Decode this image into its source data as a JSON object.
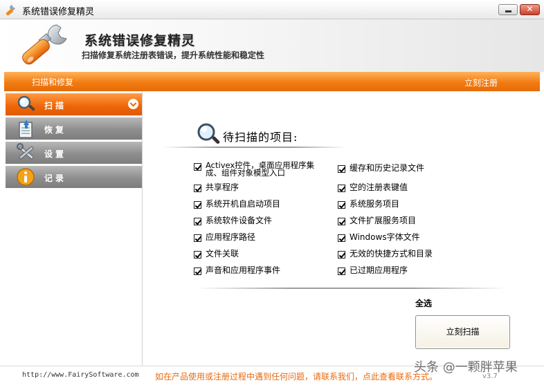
{
  "window": {
    "title": "系统错误修复精灵",
    "close_glyph": "✕"
  },
  "header": {
    "title": "系统错误修复精灵",
    "subtitle": "扫描修复系统注册表错误，提升系统性能和稳定性",
    "logo_icon": "wrench-icon"
  },
  "nav": {
    "left_label": "扫描和修复",
    "right_link": "立刻注册"
  },
  "sidebar": {
    "items": [
      {
        "label": "扫描",
        "icon": "magnifier-icon",
        "active": true
      },
      {
        "label": "恢复",
        "icon": "restore-icon",
        "active": false
      },
      {
        "label": "设置",
        "icon": "tools-icon",
        "active": false
      },
      {
        "label": "记录",
        "icon": "info-icon",
        "active": false
      }
    ]
  },
  "main": {
    "section_title": "待扫描的项目:",
    "left_items": [
      {
        "label": "Activex控件，桌面应用程序集成、组件对象模型入口",
        "checked": true
      },
      {
        "label": "共享程序",
        "checked": true
      },
      {
        "label": "系统开机自启动项目",
        "checked": true
      },
      {
        "label": "系统软件设备文件",
        "checked": true
      },
      {
        "label": "应用程序路径",
        "checked": true
      },
      {
        "label": "文件关联",
        "checked": true
      },
      {
        "label": "声音和应用程序事件",
        "checked": true
      }
    ],
    "right_items": [
      {
        "label": "缓存和历史记录文件",
        "checked": true
      },
      {
        "label": "空的注册表键值",
        "checked": true
      },
      {
        "label": "系统服务项目",
        "checked": true
      },
      {
        "label": "文件扩展服务项目",
        "checked": true
      },
      {
        "label": "Windows字体文件",
        "checked": true
      },
      {
        "label": "无效的快捷方式和目录",
        "checked": true
      },
      {
        "label": "已过期应用程序",
        "checked": true
      }
    ],
    "select_all": "全选",
    "scan_button": "立刻扫描"
  },
  "status": {
    "url": "http://www.FairySoftware.com",
    "message": "如在产品使用或注册过程中遇到任何问题，请联系我们，点此查看联系方式。",
    "version": "v3.7",
    "watermark": "头条 @一颗胖苹果"
  },
  "colors": {
    "accent": "#f27b12",
    "sidebar_gray": "#8e8e8e"
  }
}
